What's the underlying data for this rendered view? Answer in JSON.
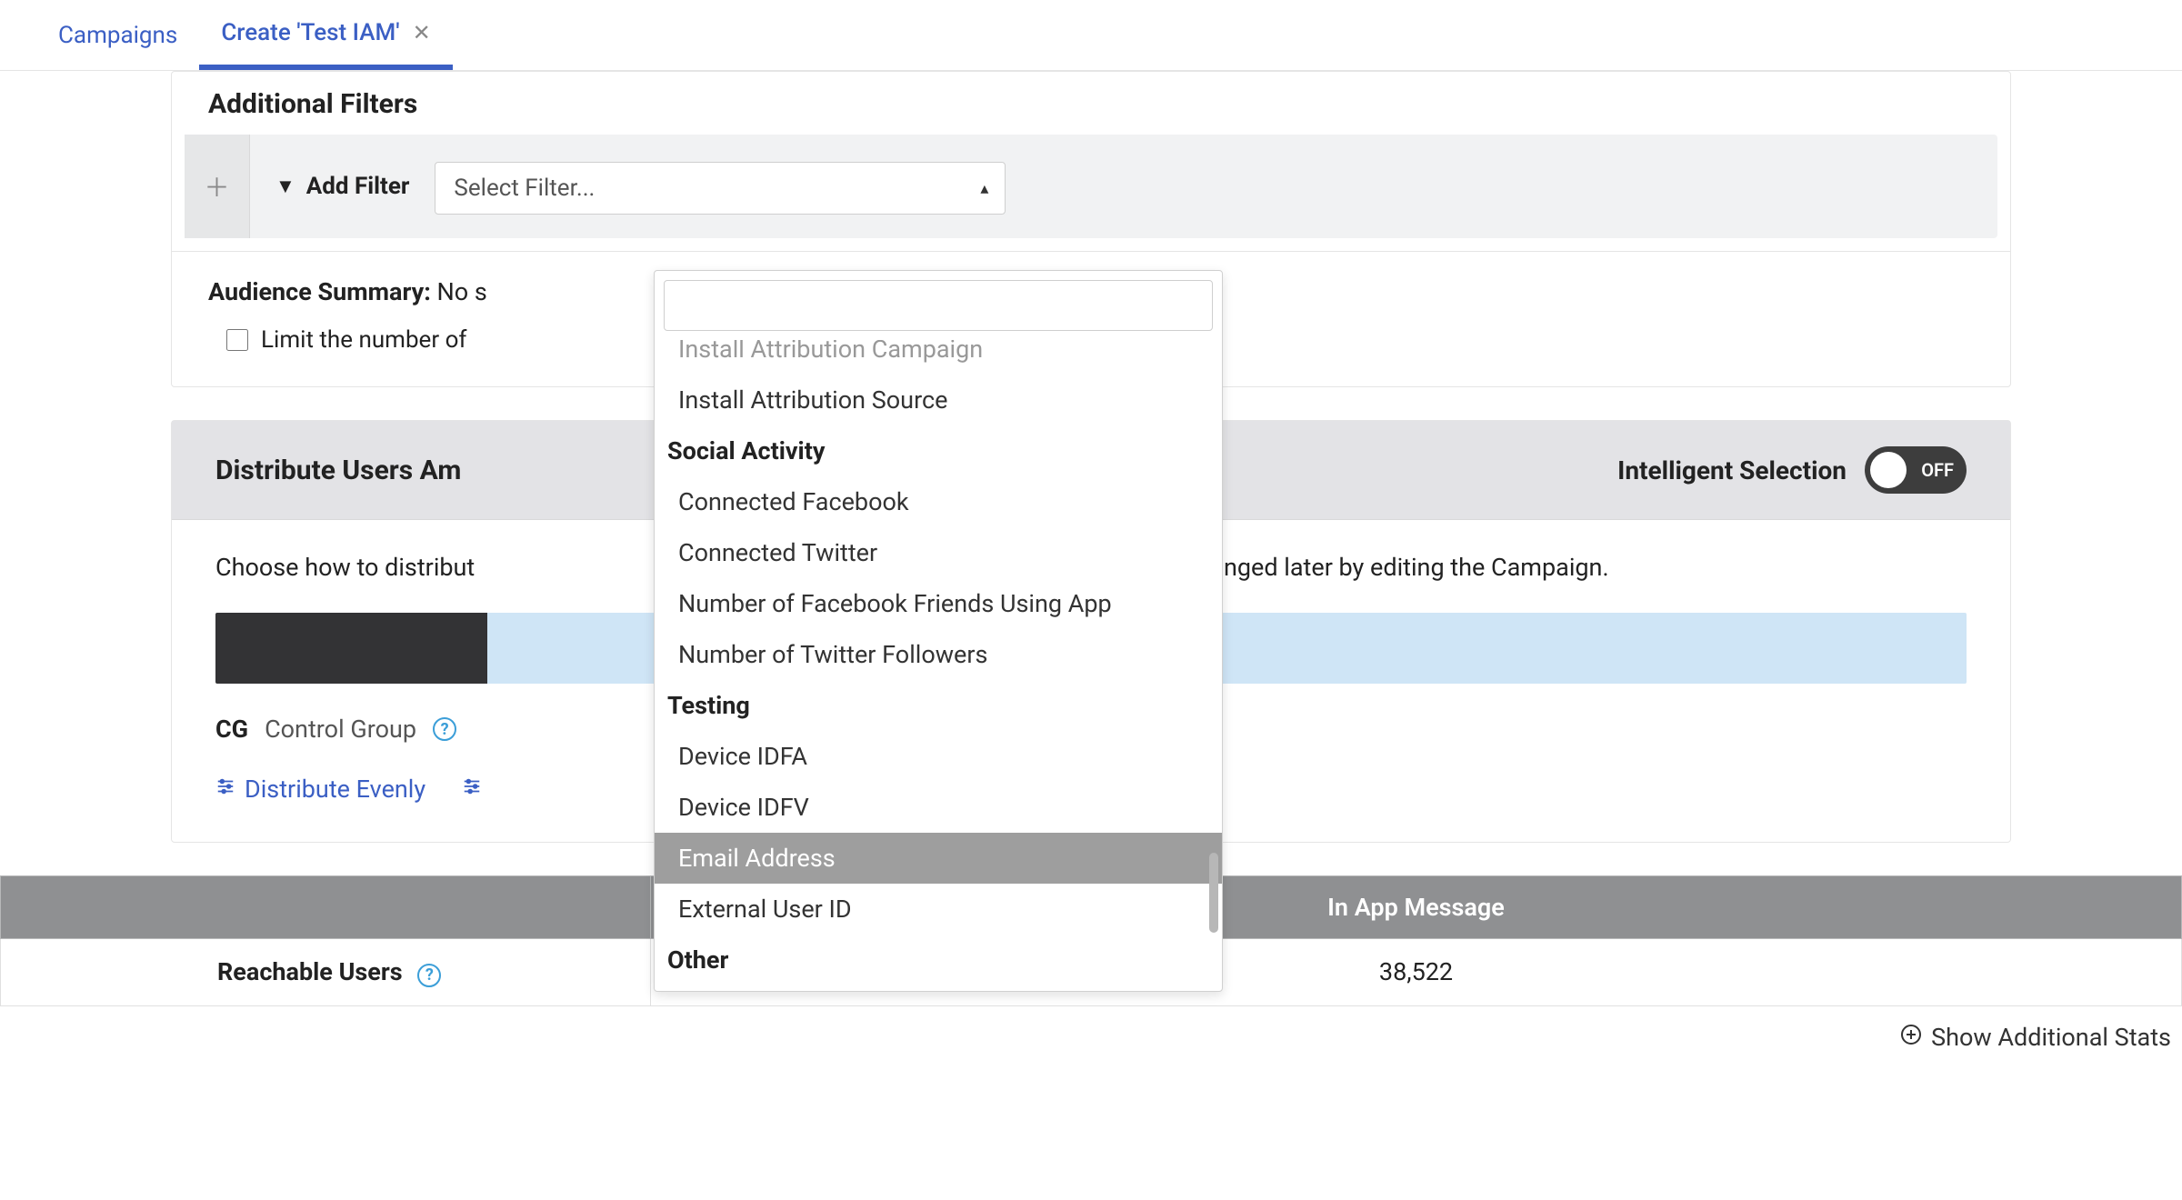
{
  "tabs": {
    "campaigns": "Campaigns",
    "create": "Create 'Test IAM'"
  },
  "filters": {
    "section_title": "Additional Filters",
    "add_filter_label": "Add Filter",
    "select_placeholder": "Select Filter..."
  },
  "dropdown": {
    "truncated_item": "Install Attribution Campaign",
    "items_1": "Install Attribution Source",
    "group_social": "Social Activity",
    "item_fb": "Connected Facebook",
    "item_tw": "Connected Twitter",
    "item_fb_friends": "Number of Facebook Friends Using App",
    "item_tw_followers": "Number of Twitter Followers",
    "group_testing": "Testing",
    "item_idfa": "Device IDFA",
    "item_idfv": "Device IDFV",
    "item_email": "Email Address",
    "item_ext_id": "External User ID",
    "group_other": "Other"
  },
  "summary": {
    "label": "Audience Summary:",
    "value": "No s"
  },
  "limit": {
    "label": "Limit the number of"
  },
  "distribute": {
    "header": "Distribute Users Am",
    "is_label": "Intelligent Selection",
    "toggle_state": "OFF",
    "desc_left": "Choose how to distribut",
    "desc_right": "anged later by editing the Campaign.",
    "cg_badge": "CG",
    "cg_label": "Control Group",
    "link_even": "Distribute Evenly",
    "bar_dark_pct": 15.5,
    "bar_light_pct": 84.5
  },
  "stats": {
    "col_blank": "",
    "col_iam": "In App Message",
    "row_reachable": "Reachable Users",
    "reachable_value": "38,522"
  },
  "footer": {
    "show_stats": "Show Additional Stats"
  }
}
